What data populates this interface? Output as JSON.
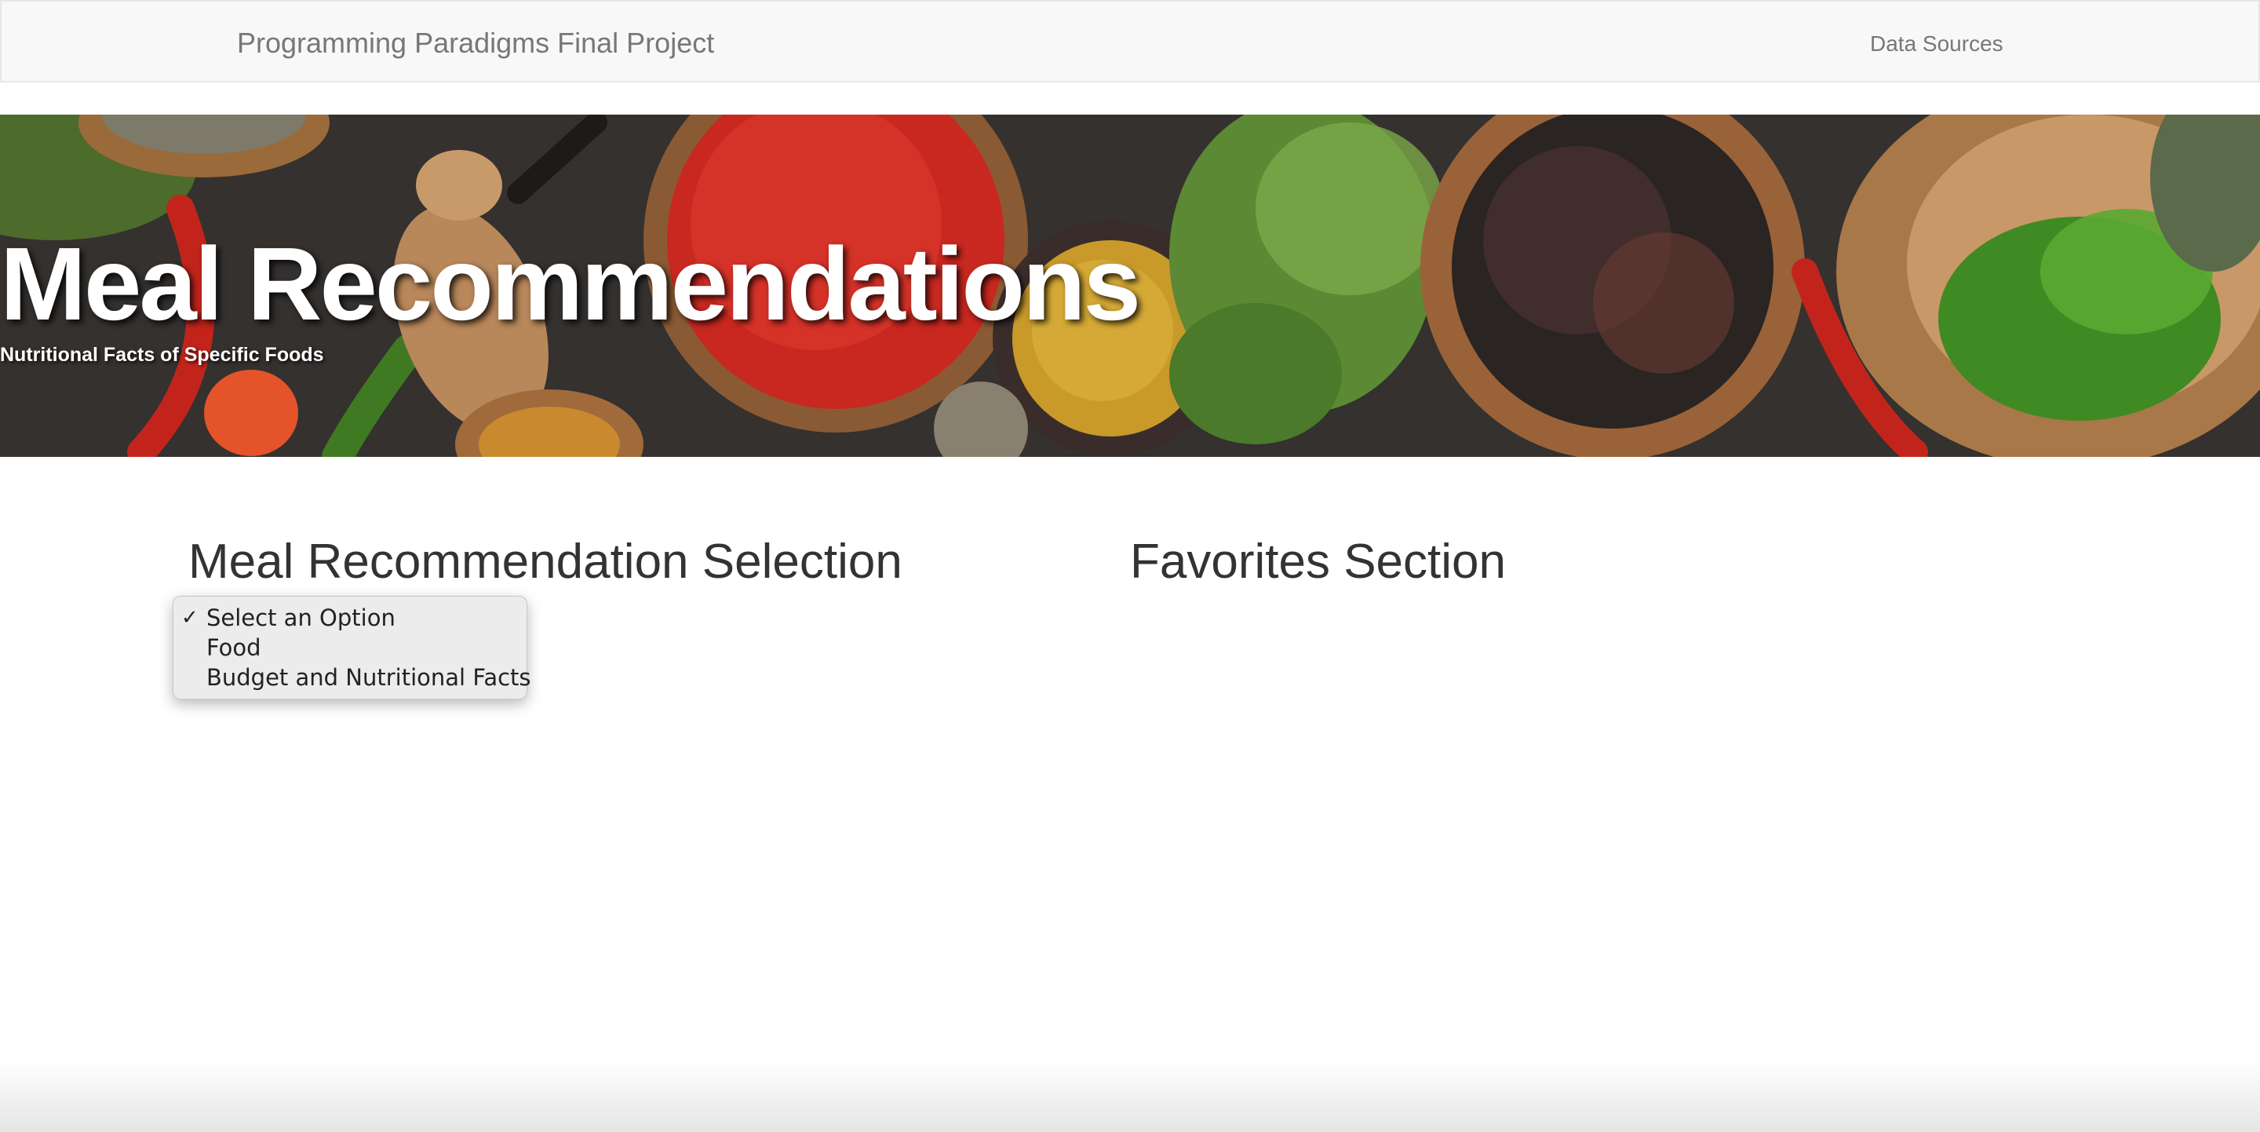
{
  "navbar": {
    "brand": "Programming Paradigms Final Project",
    "link": "Data Sources"
  },
  "hero": {
    "title": "Meal Recommendations",
    "subtitle": "Nutritional Facts of Specific Foods"
  },
  "sections": {
    "selection_title": "Meal Recommendation Selection",
    "favorites_title": "Favorites Section"
  },
  "meal_select": {
    "selected": "Select an Option",
    "options": [
      "Select an Option",
      "Food",
      "Budget and Nutritional Facts"
    ],
    "check_glyph": "✓"
  }
}
